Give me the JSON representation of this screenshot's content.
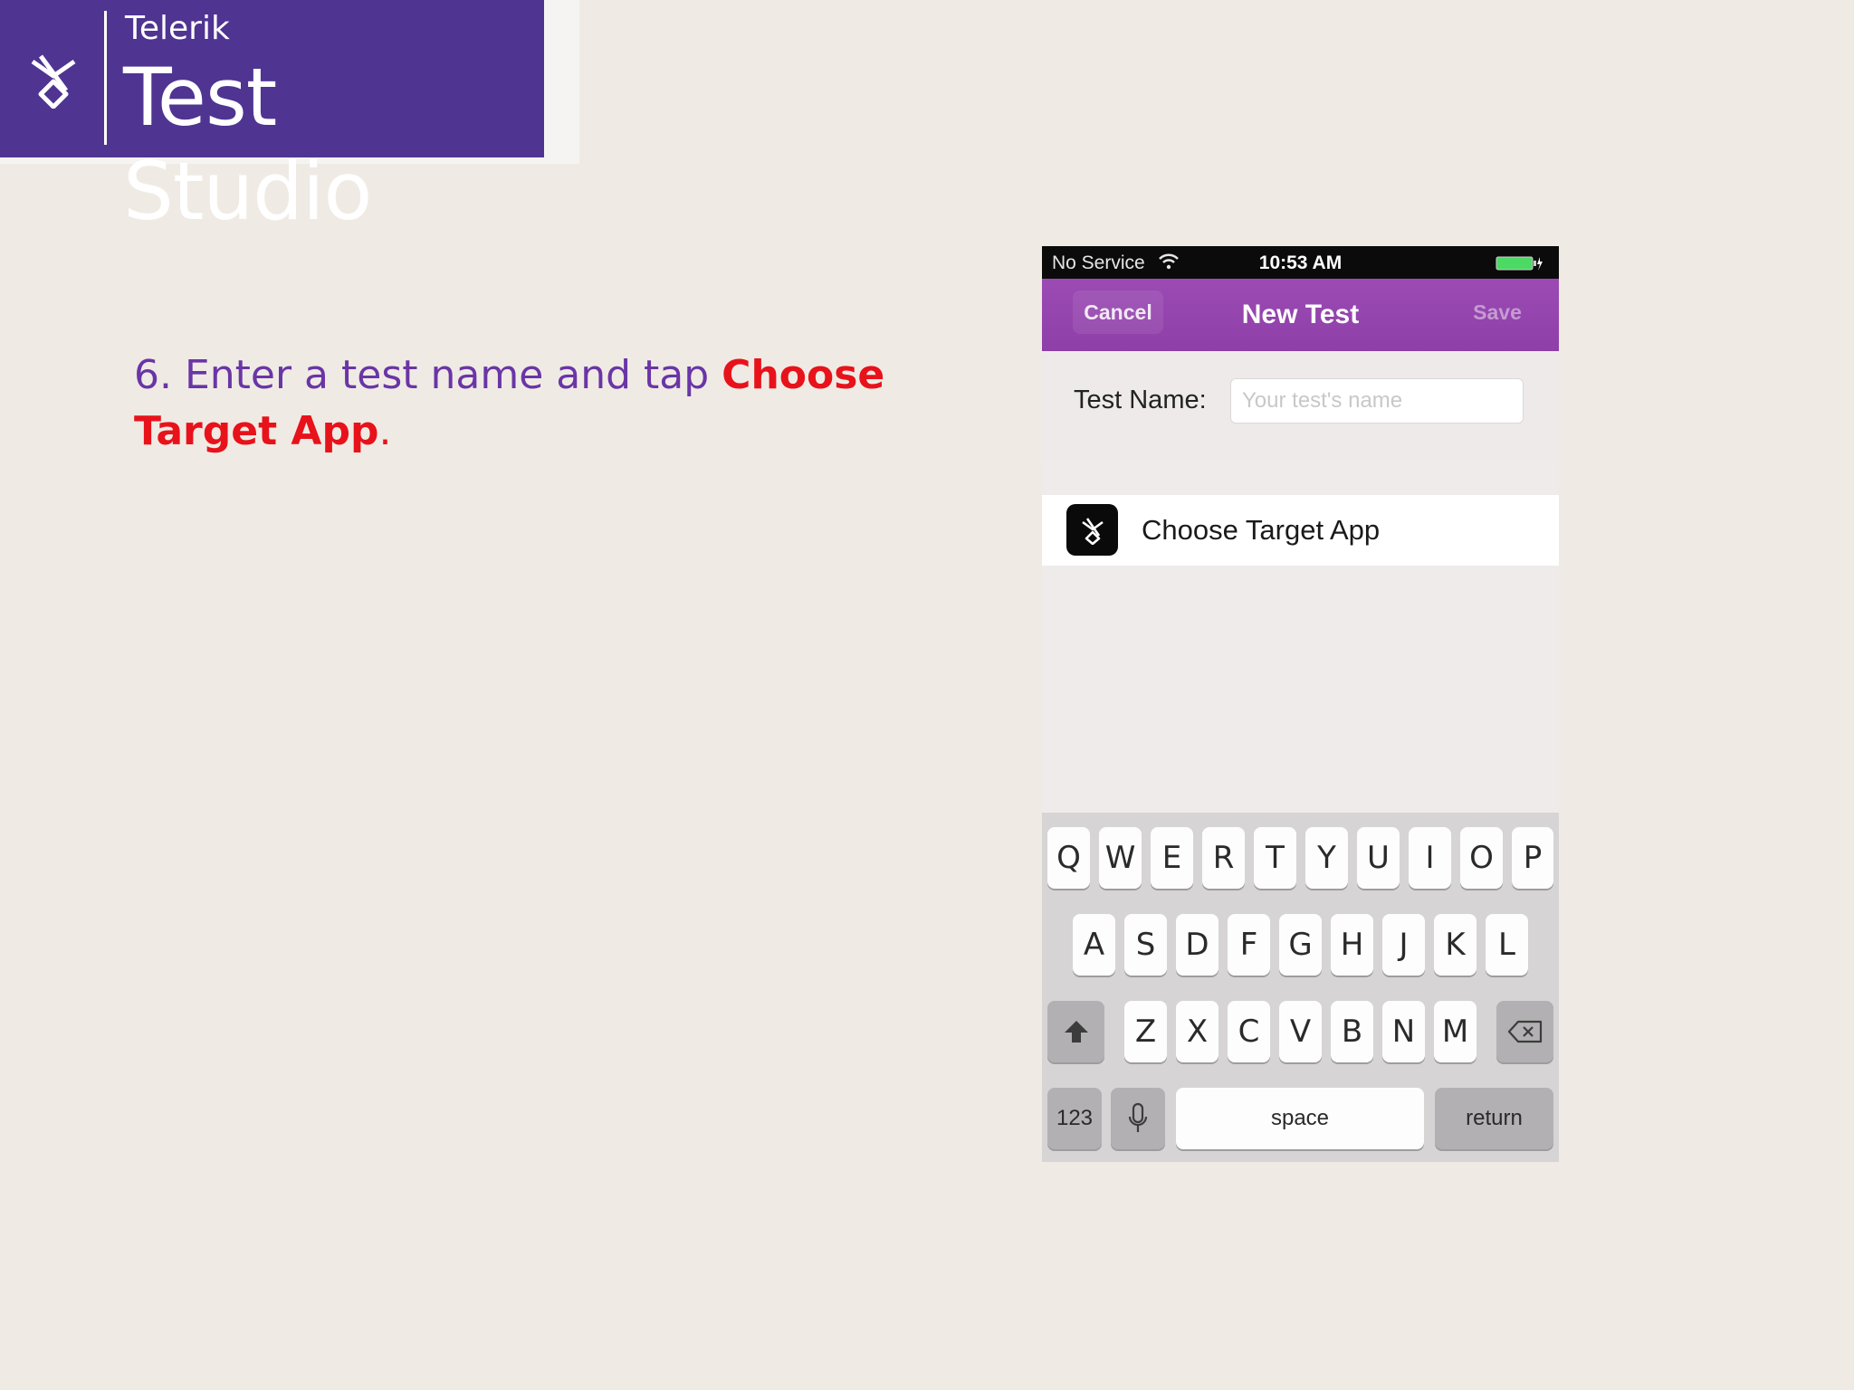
{
  "logo": {
    "company": "Telerik",
    "product": "Test Studio",
    "mark_icon": "telerik-ninja-mark-icon",
    "colors": {
      "background": "#4f3492",
      "text": "#ffffff"
    }
  },
  "instruction": {
    "prefix": "6. Enter a test name and tap ",
    "highlight": "Choose Target App",
    "suffix": ".",
    "colors": {
      "text": "#6a35a6",
      "highlight": "#e8121b"
    }
  },
  "phone": {
    "status_bar": {
      "carrier": "No Service",
      "time": "10:53 AM",
      "wifi_icon": "wifi-icon",
      "battery_icon": "battery-charging-icon"
    },
    "nav": {
      "cancel_label": "Cancel",
      "title": "New Test",
      "save_label": "Save",
      "color": "#963fae"
    },
    "form": {
      "test_name_label": "Test Name:",
      "test_name_placeholder": "Your test's name",
      "test_name_value": ""
    },
    "target": {
      "label": "Choose Target App",
      "icon": "test-studio-app-icon"
    },
    "keyboard": {
      "row1": [
        "Q",
        "W",
        "E",
        "R",
        "T",
        "Y",
        "U",
        "I",
        "O",
        "P"
      ],
      "row2": [
        "A",
        "S",
        "D",
        "F",
        "G",
        "H",
        "J",
        "K",
        "L"
      ],
      "row3": [
        "Z",
        "X",
        "C",
        "V",
        "B",
        "N",
        "M"
      ],
      "shift_icon": "shift-icon",
      "backspace_icon": "backspace-icon",
      "numbers_label": "123",
      "mic_icon": "microphone-icon",
      "space_label": "space",
      "return_label": "return"
    }
  }
}
